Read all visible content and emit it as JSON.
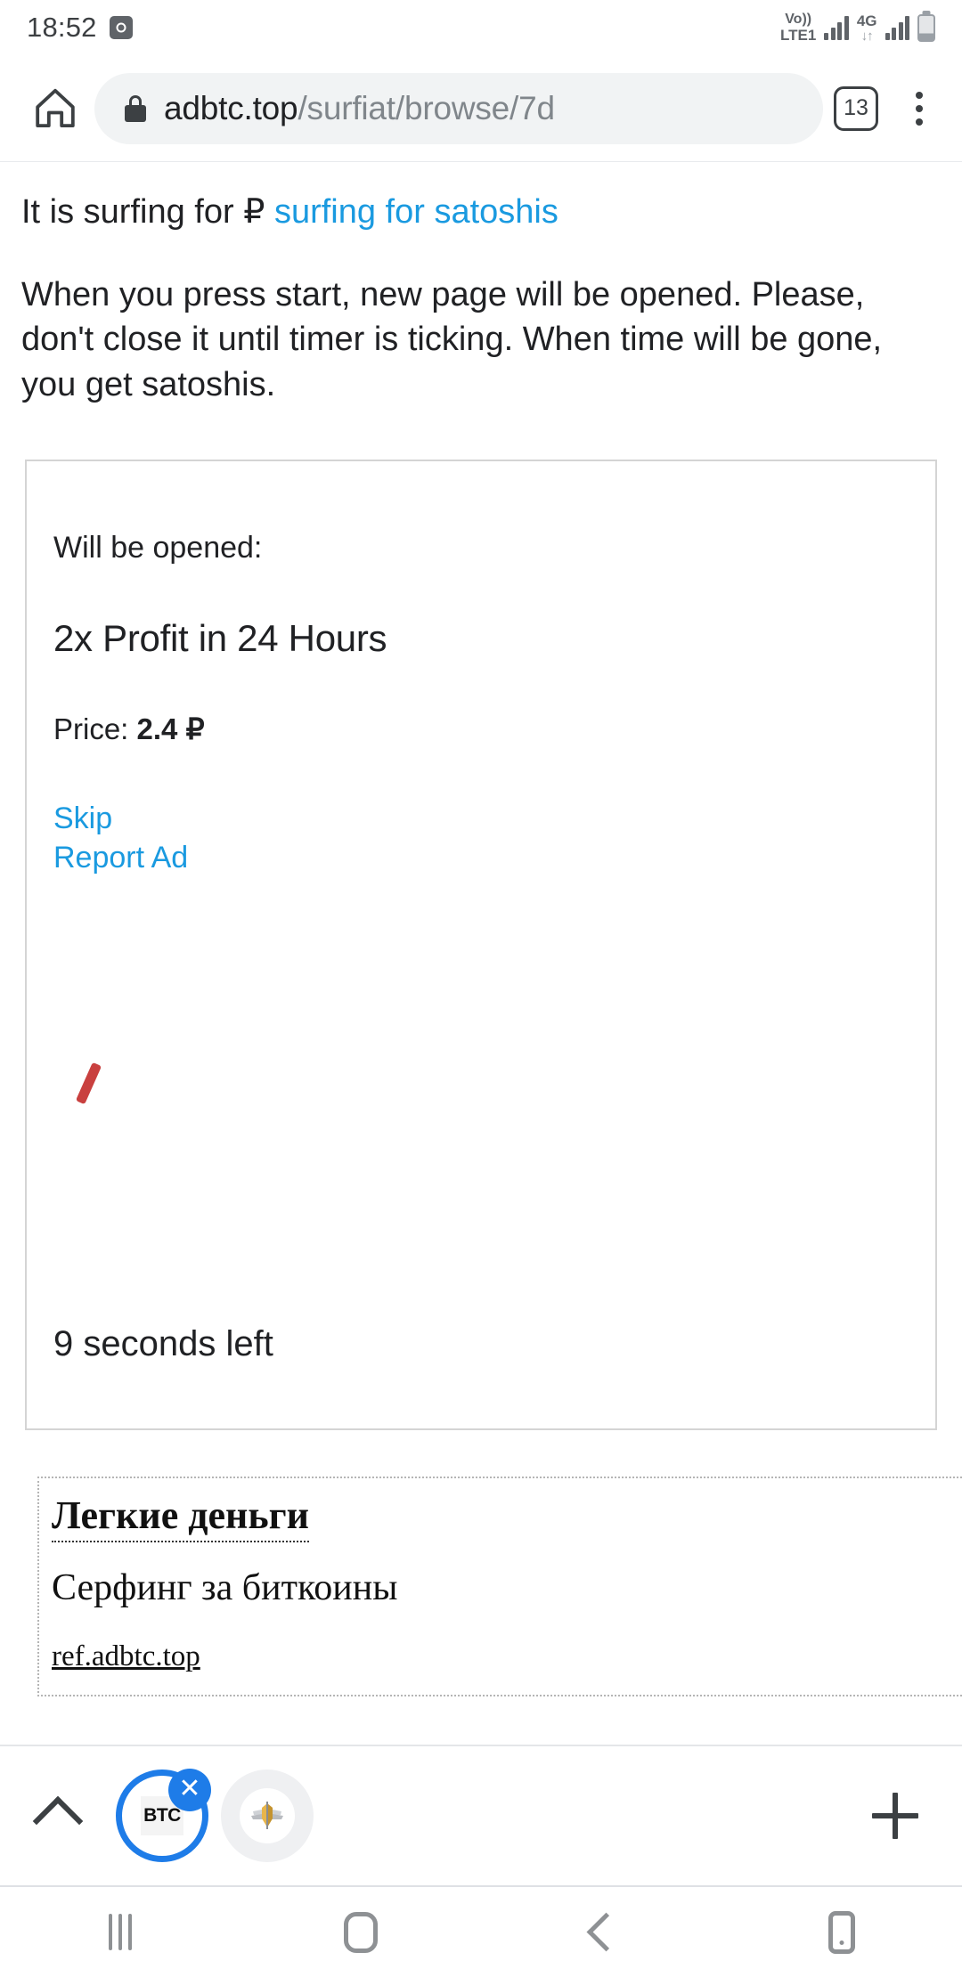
{
  "status_bar": {
    "clock": "18:52",
    "alarm_icon": "alarm-icon",
    "volte_line1": "Vo))",
    "volte_line2": "LTE1",
    "network_type": "4G",
    "data_arrows": "↓↑",
    "battery_icon": "battery-icon"
  },
  "browser": {
    "home_icon": "home-icon",
    "lock_icon": "lock-icon",
    "url_domain": "adbtc.top",
    "url_path": "/surfiat/browse/7d",
    "tab_count": "13",
    "menu_icon": "kebab-menu-icon"
  },
  "content": {
    "surf_prefix": "It is surfing for ₽ ",
    "surf_link": "surfing for satoshis",
    "instructions": "When you press start, new page will be opened. Please, don't close it until timer is ticking. When time will be gone, you get satoshis."
  },
  "ad_card": {
    "will_be_opened": "Will be opened:",
    "offer_title": "2x Profit in 24 Hours",
    "price_label": "Price: ",
    "price_value": "2.4 ₽",
    "skip_link": "Skip",
    "report_link": "Report Ad",
    "broken_image_icon": "broken-image-icon",
    "timer_text": "9 seconds left"
  },
  "ru_ad": {
    "title": "Легкие деньги",
    "description": "Серфинг за биткоины",
    "url": "ref.adbtc.top"
  },
  "tab_strip": {
    "expand_icon": "chevron-up-icon",
    "tab1_label": "BTC",
    "tab1_close_icon": "close-icon",
    "tab2_icon": "winged-shield-favicon",
    "new_tab_icon": "plus-icon"
  },
  "nav_bar": {
    "recents_icon": "recents-icon",
    "home_icon": "home-square-icon",
    "back_icon": "back-chevron-icon",
    "device_icon": "device-icon"
  },
  "colors": {
    "link_blue": "#1a9ae0",
    "accent_blue": "#1e7ce8",
    "red_mark": "#c9403f"
  }
}
